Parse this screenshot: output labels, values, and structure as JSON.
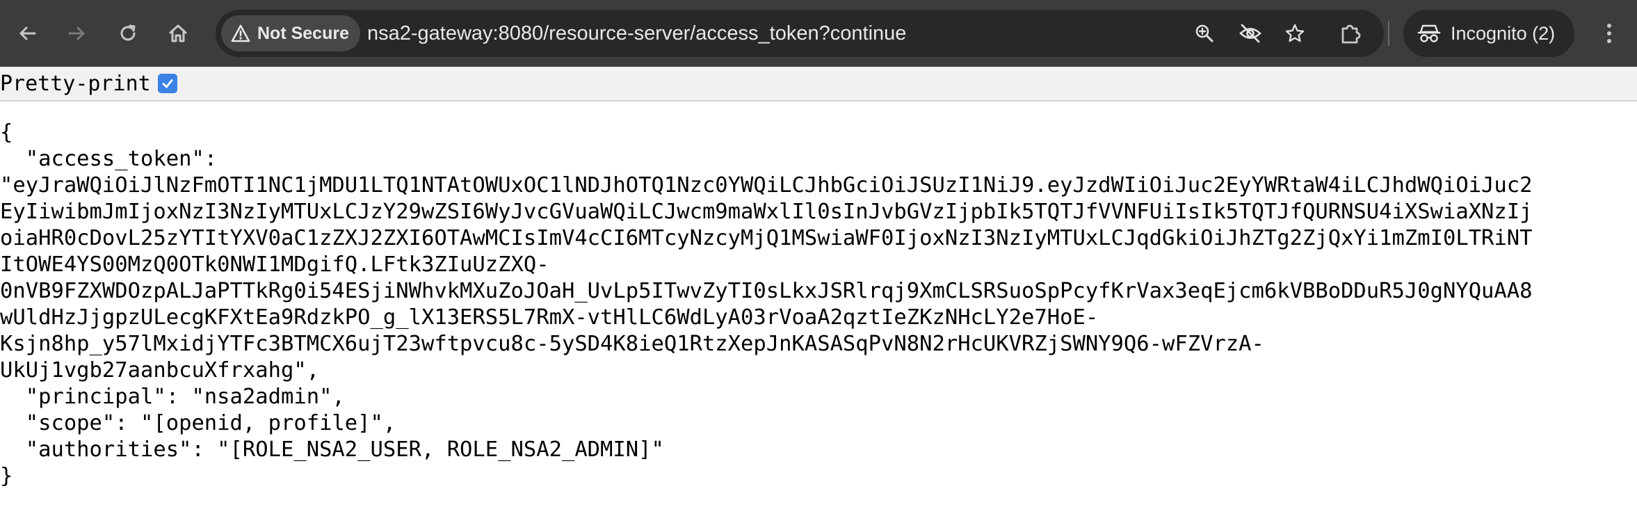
{
  "browser": {
    "icons": {
      "back": "arrow-left-icon",
      "forward": "arrow-right-icon",
      "reload": "reload-icon",
      "home": "home-icon",
      "warning": "warning-triangle-icon",
      "zoom": "zoom-icon",
      "eye_off": "eye-off-icon",
      "bookmark": "star-icon",
      "extensions": "puzzle-icon",
      "incognito": "incognito-icon",
      "menu": "kebab-menu-icon"
    },
    "security_chip": "Not Secure",
    "url": "nsa2-gateway:8080/resource-server/access_token?continue",
    "incognito_label": "Incognito (2)"
  },
  "viewer": {
    "pretty_print_label": "Pretty-print",
    "pretty_print_checked": true,
    "json_lines": [
      "{",
      "  \"access_token\":",
      "\"eyJraWQiOiJlNzFmOTI1NC1jMDU1LTQ1NTAtOWUxOC1lNDJhOTQ1Nzc0YWQiLCJhbGciOiJSUzI1NiJ9.eyJzdWIiOiJuc2EyYWRtaW4iLCJhdWQiOiJuc2",
      "EyIiwibmJmIjoxNzI3NzIyMTUxLCJzY29wZSI6WyJvcGVuaWQiLCJwcm9maWxlIl0sInJvbGVzIjpbIk5TQTJfVVNFUiIsIk5TQTJfQURNSU4iXSwiaXNzIj",
      "oiaHR0cDovL25zYTItYXV0aC1zZXJ2ZXI6OTAwMCIsImV4cCI6MTcyNzcyMjQ1MSwiaWF0IjoxNzI3NzIyMTUxLCJqdGkiOiJhZTg2ZjQxYi1mZmI0LTRiNT",
      "ItOWE4YS00MzQ0OTk0NWI1MDgifQ.LFtk3ZIuUzZXQ-",
      "0nVB9FZXWDOzpALJaPTTkRg0i54ESjiNWhvkMXuZoJOaH_UvLp5ITwvZyTI0sLkxJSRlrqj9XmCLSRSuoSpPcyfKrVax3eqEjcm6kVBBoDDuR5J0gNYQuAA8",
      "wUldHzJjgpzULecgKFXtEa9RdzkPO_g_lX13ERS5L7RmX-vtHlLC6WdLyA03rVoaA2qztIeZKzNHcLY2e7HoE-",
      "Ksjn8hp_y57lMxidjYTFc3BTMCX6ujT23wftpvcu8c-5ySD4K8ieQ1RtzXepJnKASASqPvN8N2rHcUKVRZjSWNY9Q6-wFZVrzA-",
      "UkUj1vgb27aanbcuXfrxahg\",",
      "  \"principal\": \"nsa2admin\",",
      "  \"scope\": \"[openid, profile]\",",
      "  \"authorities\": \"[ROLE_NSA2_USER, ROLE_NSA2_ADMIN]\"",
      "}"
    ]
  }
}
